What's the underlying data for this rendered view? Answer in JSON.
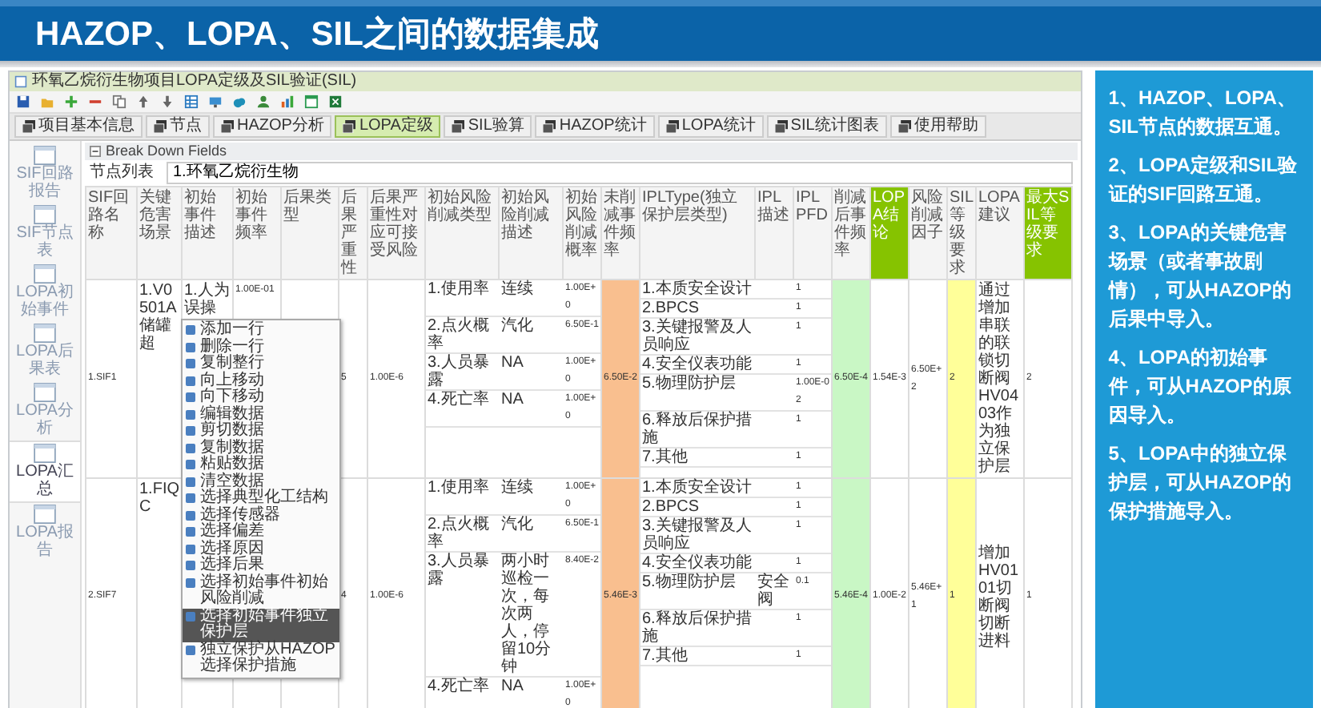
{
  "header": {
    "title": "HAZOP、LOPA、SIL之间的数据集成"
  },
  "app": {
    "title": "环氧乙烷衍生物项目LOPA定级及SIL验证(SIL)",
    "tabs": [
      {
        "label": "项目基本信息",
        "selected": false
      },
      {
        "label": "节点",
        "selected": false
      },
      {
        "label": "HAZOP分析",
        "selected": false
      },
      {
        "label": "LOPA定级",
        "selected": true
      },
      {
        "label": "SIL验算",
        "selected": false
      },
      {
        "label": "HAZOP统计",
        "selected": false
      },
      {
        "label": "LOPA统计",
        "selected": false
      },
      {
        "label": "SIL统计图表",
        "selected": false
      },
      {
        "label": "使用帮助",
        "selected": false
      }
    ],
    "sidebar": [
      {
        "label": "SIF回路报告",
        "selected": false
      },
      {
        "label": "SIF节点表",
        "selected": false
      },
      {
        "label": "LOPA初始事件",
        "selected": false
      },
      {
        "label": "LOPA后果表",
        "selected": false
      },
      {
        "label": "LOPA分析",
        "selected": false
      },
      {
        "label": "LOPA汇总",
        "selected": true
      },
      {
        "label": "LOPA报告",
        "selected": false
      }
    ],
    "section": "Break Down Fields",
    "node_list": {
      "label": "节点列表",
      "value": "1.环氧乙烷衍生物"
    },
    "table": {
      "columns": [
        {
          "label": "SIF回路名称",
          "highlighted": false
        },
        {
          "label": "关键危害场景",
          "highlighted": false
        },
        {
          "label": "初始事件描述",
          "highlighted": false
        },
        {
          "label": "初始事件频率",
          "highlighted": false
        },
        {
          "label": "后果类型",
          "highlighted": false
        },
        {
          "label": "后果严重性",
          "highlighted": false
        },
        {
          "label": "后果严重性对应可接受风险",
          "highlighted": false
        },
        {
          "label": "初始风险削减类型",
          "highlighted": false
        },
        {
          "label": "初始风险削减描述",
          "highlighted": false
        },
        {
          "label": "初始风险削减概率",
          "highlighted": false
        },
        {
          "label": "未削减事件频率",
          "highlighted": false,
          "color": "#f9bf8f"
        },
        {
          "label": "IPLType(独立保护层类型)",
          "highlighted": false
        },
        {
          "label": "IPL描述",
          "highlighted": false
        },
        {
          "label": "IPLPFD",
          "highlighted": false
        },
        {
          "label": "削减后事件频率",
          "highlighted": false,
          "color": "#c9f7c5"
        },
        {
          "label": "LOPA结论",
          "highlighted": true
        },
        {
          "label": "风险削减因子",
          "highlighted": false
        },
        {
          "label": "SIL等级要求",
          "highlighted": false,
          "color": "#ffff99"
        },
        {
          "label": "LOPA建议",
          "highlighted": false
        },
        {
          "label": "最大SIL等级要求",
          "highlighted": true
        }
      ],
      "rows": [
        {
          "sif": "1.SIF1",
          "scenario": "1.V0501A储罐超",
          "event_desc": "1.人为误操",
          "event_freq": "1.00E-01",
          "severity": "5",
          "tolerable_risk": "1.00E-6",
          "modifiers": [
            {
              "type": "1.使用率",
              "desc": "连续",
              "prob": "1.00E+0"
            },
            {
              "type": "2.点火概率",
              "desc": "汽化",
              "prob": "6.50E-1"
            },
            {
              "type": "3.人员暴露",
              "desc": "NA",
              "prob": "1.00E+0"
            },
            {
              "type": "4.死亡率",
              "desc": "NA",
              "prob": "1.00E+0"
            }
          ],
          "unmitigated_freq": "6.50E-2",
          "ipls": [
            {
              "type": "1.本质安全设计",
              "pfd": "1"
            },
            {
              "type": "2.BPCS",
              "pfd": "1"
            },
            {
              "type": "3.关键报警及人员响应",
              "pfd": "1"
            },
            {
              "type": "4.安全仪表功能",
              "pfd": "1"
            },
            {
              "type": "5.物理防护层",
              "pfd": "1.00E-02"
            },
            {
              "type": "6.释放后保护措施",
              "pfd": "1"
            },
            {
              "type": "7.其他",
              "pfd": "1"
            }
          ],
          "mitigated_freq": "6.50E-4",
          "lopa_result": "1.54E-3",
          "rrf": "6.50E+2",
          "sil_required": "2",
          "lopa_advice": "通过增加串联的联锁切断阀HV0403作为独立保护层",
          "max_sil": "2"
        },
        {
          "sif": "2.SIF7",
          "scenario": "1.FIQC",
          "severity": "4",
          "tolerable_risk": "1.00E-6",
          "modifiers": [
            {
              "type": "1.使用率",
              "desc": "连续",
              "prob": "1.00E+0"
            },
            {
              "type": "2.点火概率",
              "desc": "汽化",
              "prob": "6.50E-1"
            },
            {
              "type": "3.人员暴露",
              "desc": "两小时巡检一次，每次两人，停留10分钟",
              "prob": "8.40E-2"
            },
            {
              "type": "4.死亡率",
              "desc": "NA",
              "prob": "1.00E+0"
            }
          ],
          "unmitigated_freq": "5.46E-3",
          "ipls": [
            {
              "type": "1.本质安全设计",
              "pfd": "1"
            },
            {
              "type": "2.BPCS",
              "pfd": "1"
            },
            {
              "type": "3.关键报警及人员响应",
              "pfd": "1"
            },
            {
              "type": "4.安全仪表功能",
              "pfd": "1"
            },
            {
              "type": "5.物理防护层",
              "desc": "安全阀",
              "pfd": "0.1"
            },
            {
              "type": "6.释放后保护措施",
              "pfd": "1"
            },
            {
              "type": "7.其他",
              "pfd": "1"
            }
          ],
          "mitigated_freq": "5.46E-4",
          "lopa_result": "1.00E-2",
          "rrf": "5.46E+1",
          "sil_required": "1",
          "lopa_advice": "增加HV0101切断阀切断进料",
          "max_sil": "1"
        }
      ]
    },
    "context_menu": [
      {
        "label": "添加一行",
        "selected": false
      },
      {
        "label": "删除一行",
        "selected": false
      },
      {
        "label": "复制整行",
        "selected": false
      },
      {
        "label": "向上移动",
        "selected": false
      },
      {
        "label": "向下移动",
        "selected": false
      },
      {
        "label": "编辑数据",
        "selected": false
      },
      {
        "label": "剪切数据",
        "selected": false
      },
      {
        "label": "复制数据",
        "selected": false
      },
      {
        "label": "粘贴数据",
        "selected": false
      },
      {
        "label": "清空数据",
        "selected": false
      },
      {
        "label": "选择典型化工结构",
        "selected": false
      },
      {
        "label": "选择传感器",
        "selected": false
      },
      {
        "label": "选择偏差",
        "selected": false
      },
      {
        "label": "选择原因",
        "selected": false
      },
      {
        "label": "选择后果",
        "selected": false
      },
      {
        "label": "选择初始事件初始风险削减",
        "selected": false
      },
      {
        "label": "选择初始事件独立保护层",
        "selected": true
      },
      {
        "label": "独立保护从HAZOP选择保护措施",
        "selected": false
      }
    ]
  },
  "notes": [
    "1、HAZOP、LOPA、SIL节点的数据互通。",
    "2、LOPA定级和SIL验证的SIF回路互通。",
    "3、LOPA的关键危害场景（或者事故剧情），可从HAZOP的后果中导入。",
    "4、LOPA的初始事件，可从HAZOP的原因导入。",
    "5、LOPA中的独立保护层，可从HAZOP的保护措施导入。"
  ]
}
